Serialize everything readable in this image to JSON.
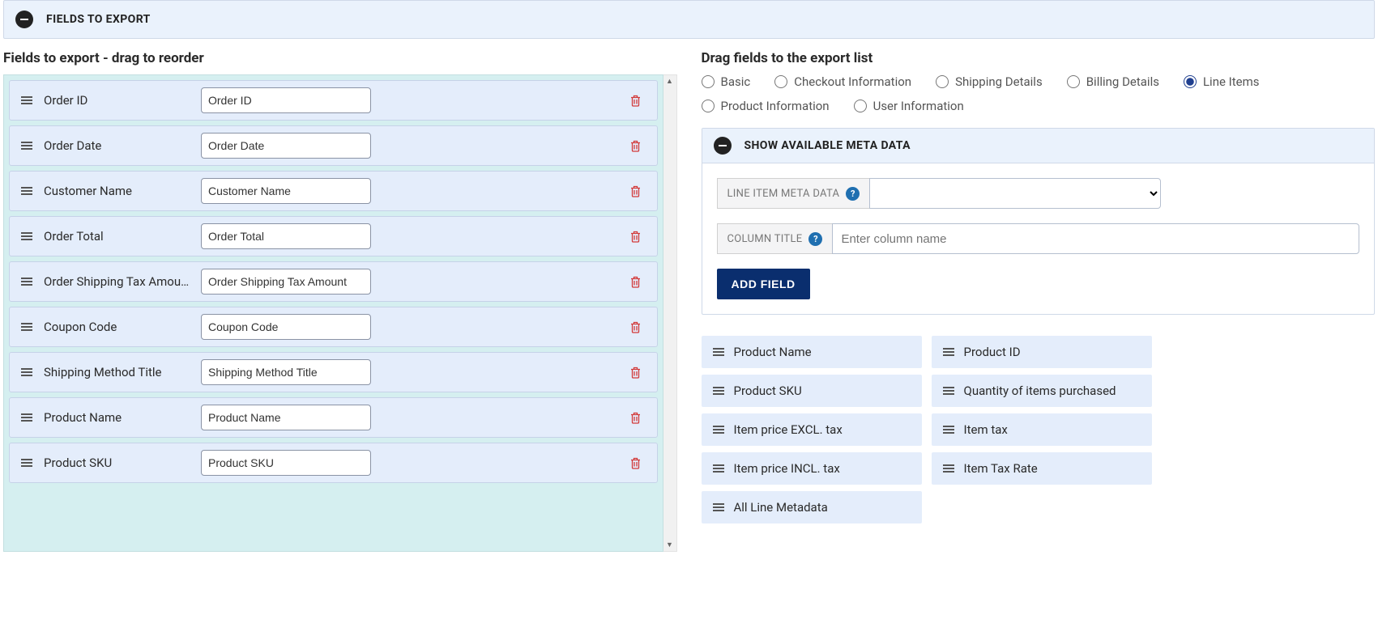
{
  "header": {
    "title": "FIELDS TO EXPORT"
  },
  "left": {
    "subheading": "Fields to export - drag to reorder",
    "fields": [
      {
        "label": "Order ID",
        "value": "Order ID"
      },
      {
        "label": "Order Date",
        "value": "Order Date"
      },
      {
        "label": "Customer Name",
        "value": "Customer Name"
      },
      {
        "label": "Order Total",
        "value": "Order Total"
      },
      {
        "label": "Order Shipping Tax Amount",
        "value": "Order Shipping Tax Amount"
      },
      {
        "label": "Coupon Code",
        "value": "Coupon Code"
      },
      {
        "label": "Shipping Method Title",
        "value": "Shipping Method Title"
      },
      {
        "label": "Product Name",
        "value": "Product Name"
      },
      {
        "label": "Product SKU",
        "value": "Product SKU"
      }
    ]
  },
  "right": {
    "subheading": "Drag fields to the export list",
    "tabs": [
      {
        "label": "Basic",
        "selected": false
      },
      {
        "label": "Checkout Information",
        "selected": false
      },
      {
        "label": "Shipping Details",
        "selected": false
      },
      {
        "label": "Billing Details",
        "selected": false
      },
      {
        "label": "Line Items",
        "selected": true
      },
      {
        "label": "Product Information",
        "selected": false
      },
      {
        "label": "User Information",
        "selected": false
      }
    ],
    "meta": {
      "header": "SHOW AVAILABLE META DATA",
      "labelA": "LINE ITEM META DATA",
      "selectValue": "",
      "labelB": "COLUMN TITLE",
      "columnPlaceholder": "Enter column name",
      "button": "ADD FIELD"
    },
    "available": {
      "colA": [
        "Product Name",
        "Product SKU",
        "Item price EXCL. tax",
        "Item price INCL. tax",
        "All Line Metadata"
      ],
      "colB": [
        "Product ID",
        "Quantity of items purchased",
        "Item tax",
        "Item Tax Rate"
      ]
    }
  }
}
